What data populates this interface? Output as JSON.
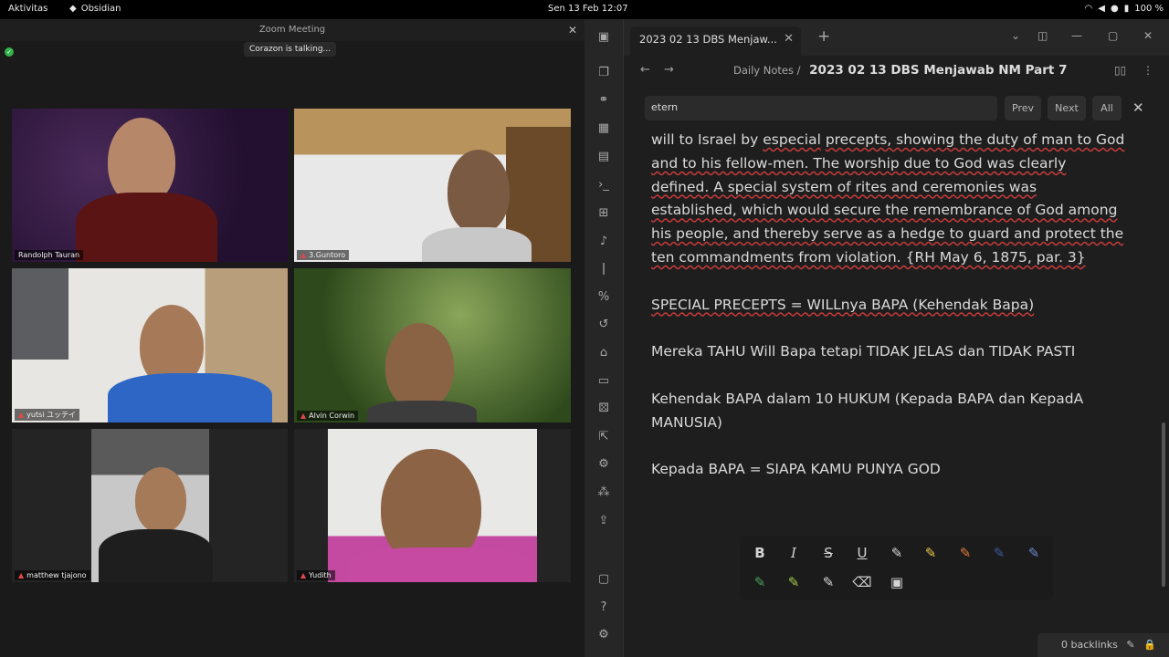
{
  "topbar": {
    "activities": "Aktivitas",
    "app": "Obsidian",
    "clock": "Sen 13 Feb  12:07",
    "battery": "100 %"
  },
  "zoom": {
    "title": "Zoom Meeting",
    "talking": "Corazon is talking...",
    "participants": [
      {
        "name": "Randolph Tauran"
      },
      {
        "name": "3.Guntoro"
      },
      {
        "name": "yutsi ユッテイ"
      },
      {
        "name": "Alvin Corwin"
      },
      {
        "name": "matthew tjajono"
      },
      {
        "name": "Yudith"
      }
    ]
  },
  "obsidian": {
    "tab_title": "2023 02 13 DBS Menjaw...",
    "breadcrumb_folder": "Daily Notes",
    "breadcrumb_sep": "/",
    "note_title": "2023 02 13 DBS Menjawab NM Part 7",
    "search_value": "etern",
    "prev": "Prev",
    "next": "Next",
    "all": "All",
    "para1_w1": "will to Israel by",
    "para1_w2": "especial",
    "para1_w3": "precepts, showing the duty of man to God and to his fellow-men. The worship due to God was clearly defined. A special system of rites and ceremonies was established, which would secure the remembrance of God among his people, and thereby serve as a hedge to guard and protect the ten commandments from violation. {RH May 6, 1875, par. 3}",
    "line1": "SPECIAL PRECEPTS = WILLnya BAPA (Kehendak Bapa)",
    "line2": "Mereka TAHU Will Bapa tetapi TIDAK JELAS dan TIDAK PASTI",
    "line3": "Kehendak BAPA dalam 10 HUKUM (Kepada BAPA dan KepadA MANUSIA)",
    "line4": "Kepada BAPA = SIAPA KAMU PUNYA GOD",
    "backlinks": "0 backlinks"
  }
}
